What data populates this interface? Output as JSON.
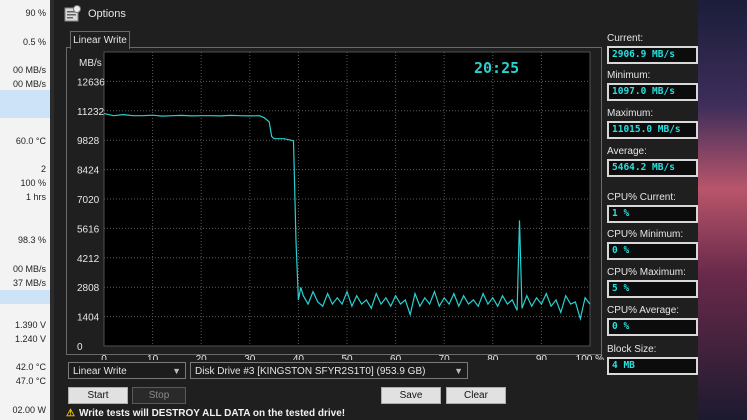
{
  "left_panel": {
    "values": [
      "90 %",
      "0.5 %",
      "00 MB/s",
      "00 MB/s",
      "60.0 °C",
      "2",
      "100 %",
      "1 hrs",
      "98.3 %",
      "00 MB/s",
      "37 MB/s",
      "1.390 V",
      "1.240 V",
      "42.0 °C",
      "47.0 °C",
      "02.00 W"
    ]
  },
  "window": {
    "title": "Options"
  },
  "tab": {
    "label": "Linear Write"
  },
  "chart_data": {
    "type": "line",
    "title": "",
    "y_unit_label": "MB/s",
    "x_unit_label": "100 %",
    "time_label": "20:25",
    "ylim": [
      0,
      14040
    ],
    "xlim": [
      0,
      100
    ],
    "yticks": [
      "0",
      "1404",
      "2808",
      "4212",
      "5616",
      "7020",
      "8424",
      "9828",
      "11232",
      "12636"
    ],
    "xticks": [
      "0",
      "10",
      "20",
      "30",
      "40",
      "50",
      "60",
      "70",
      "80",
      "90",
      "100 %"
    ],
    "grid": true,
    "line_color": "#2ad0d0",
    "series": [
      {
        "x": [
          0,
          2,
          4,
          6,
          8,
          10,
          12,
          14,
          16,
          18,
          20,
          22,
          24,
          26,
          28,
          30,
          32,
          33,
          34,
          34.5,
          35,
          36,
          37,
          38,
          39,
          39.5,
          40,
          40.5,
          41,
          42,
          43,
          44,
          45,
          46,
          47,
          48,
          49,
          50,
          51,
          52,
          53,
          54,
          55,
          56,
          57,
          58,
          59,
          60,
          61,
          62,
          63,
          64,
          65,
          66,
          67,
          68,
          69,
          70,
          71,
          72,
          73,
          74,
          75,
          76,
          77,
          78,
          79,
          80,
          81,
          82,
          83,
          84,
          85,
          85.5,
          86,
          87,
          88,
          89,
          90,
          91,
          92,
          93,
          94,
          95,
          96,
          97,
          98,
          99,
          100
        ],
        "y": [
          11100,
          11000,
          11050,
          11000,
          11000,
          11020,
          10980,
          11000,
          11010,
          10990,
          11000,
          11000,
          10990,
          11010,
          11000,
          10990,
          11000,
          10900,
          10700,
          10000,
          9900,
          9900,
          9900,
          9850,
          9800,
          5000,
          2200,
          2800,
          2400,
          2000,
          2600,
          2100,
          1900,
          2500,
          2000,
          2300,
          2000,
          2600,
          1900,
          2400,
          2000,
          2200,
          1800,
          2500,
          2000,
          2300,
          1900,
          2400,
          2000,
          2200,
          1500,
          2500,
          1900,
          2300,
          2000,
          2600,
          1900,
          2300,
          2000,
          2500,
          1900,
          2400,
          2000,
          2200,
          1900,
          2500,
          2000,
          2300,
          1900,
          2400,
          2000,
          2200,
          1700,
          6000,
          1800,
          2400,
          1900,
          2300,
          2000,
          2500,
          1900,
          2200,
          1600,
          2400,
          2000,
          2100,
          1300,
          2300,
          2000
        ]
      }
    ]
  },
  "controls": {
    "test_select": "Linear Write",
    "drive_select": "Disk Drive #3  [KINGSTON SFYR2S1T0]  (953.9 GB)",
    "start": "Start",
    "stop": "Stop",
    "save": "Save",
    "clear": "Clear"
  },
  "stats": {
    "current_label": "Current:",
    "current": "2906.9 MB/s",
    "minimum_label": "Minimum:",
    "minimum": "1097.0 MB/s",
    "maximum_label": "Maximum:",
    "maximum": "11015.0 MB/s",
    "average_label": "Average:",
    "average": "5464.2 MB/s",
    "cpu_current_label": "CPU% Current:",
    "cpu_current": "1 %",
    "cpu_minimum_label": "CPU% Minimum:",
    "cpu_minimum": "0 %",
    "cpu_maximum_label": "CPU% Maximum:",
    "cpu_maximum": "5 %",
    "cpu_average_label": "CPU% Average:",
    "cpu_average": "0 %",
    "block_size_label": "Block Size:",
    "block_size": "4 MB"
  },
  "warning": {
    "text": "Write tests will DESTROY ALL DATA on the tested drive!"
  }
}
